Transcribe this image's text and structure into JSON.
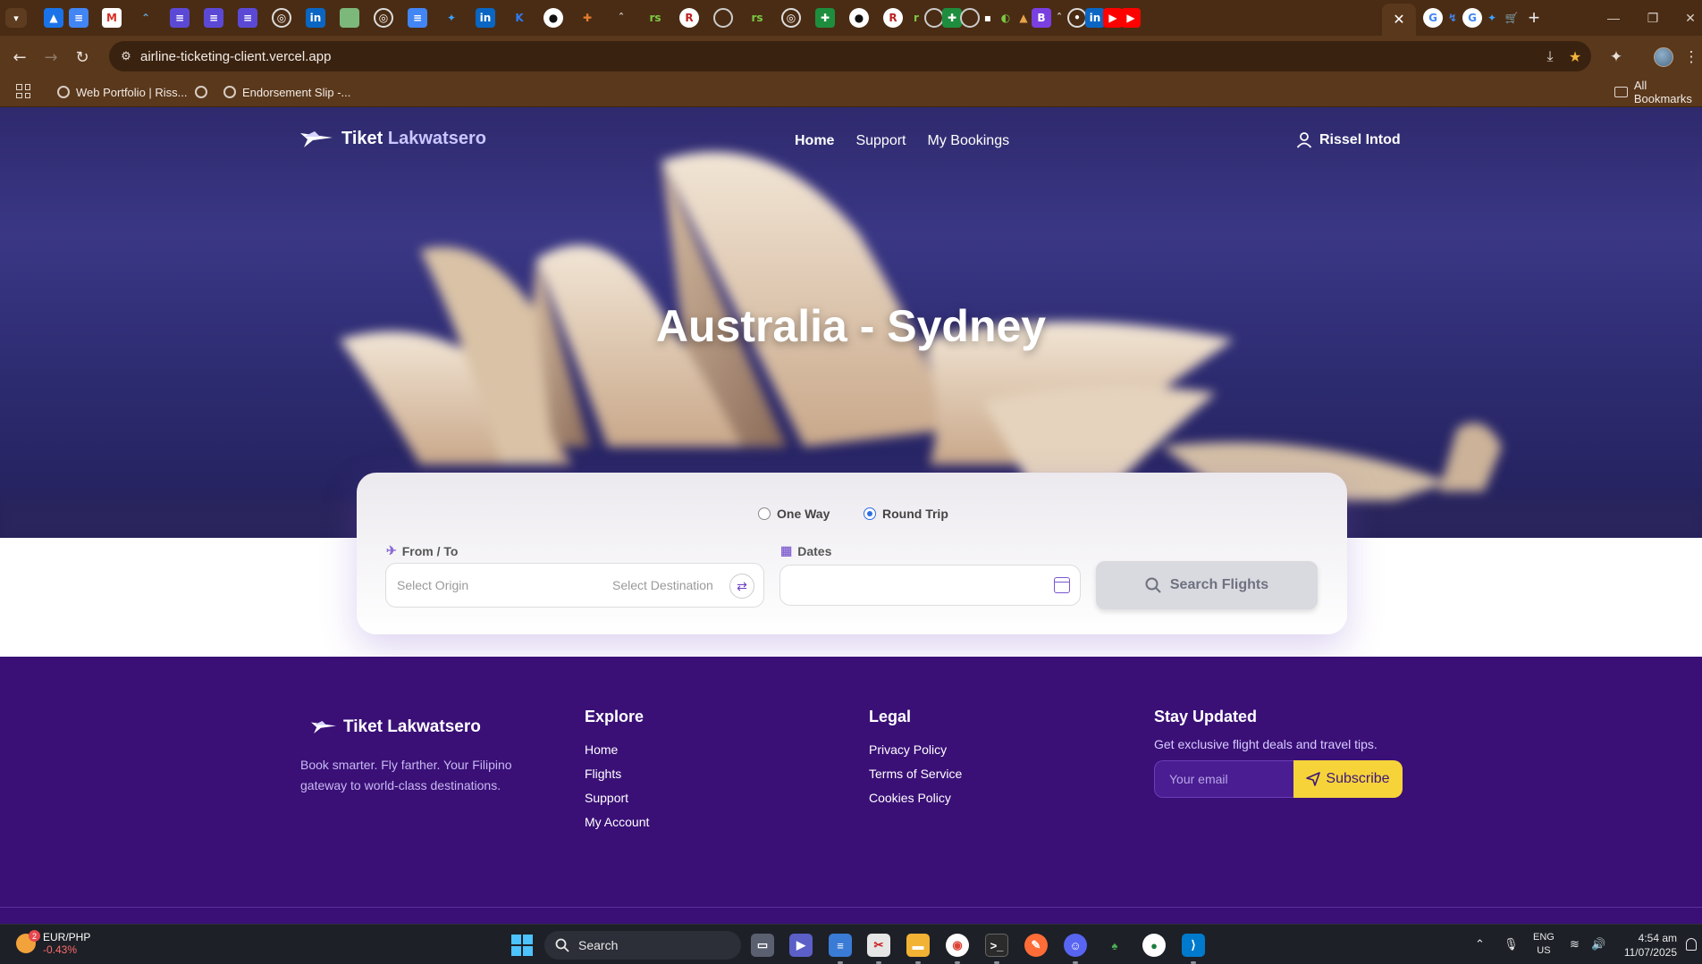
{
  "browser": {
    "url": "airline-ticketing-client.vercel.app",
    "bookmarks": [
      {
        "label": "Web Portfolio | Riss..."
      },
      {
        "label": ""
      },
      {
        "label": "Endorsement Slip -..."
      }
    ],
    "all_bookmarks_label": "All Bookmarks"
  },
  "site": {
    "brand_first": "Tiket",
    "brand_second": "Lakwatsero",
    "nav": {
      "home": "Home",
      "support": "Support",
      "my_bookings": "My Bookings"
    },
    "user_name": "Rissel Intod",
    "hero_title": "Australia - Sydney"
  },
  "search": {
    "one_way": "One Way",
    "round_trip": "Round Trip",
    "selected_trip": "Round Trip",
    "from_to_label": "From / To",
    "origin_placeholder": "Select Origin",
    "destination_placeholder": "Select Destination",
    "dates_label": "Dates",
    "dates_value": "",
    "search_button": "Search Flights"
  },
  "footer": {
    "brand": "Tiket Lakwatsero",
    "tagline": "Book smarter. Fly farther. Your Filipino gateway to world-class destinations.",
    "explore": {
      "title": "Explore",
      "links": [
        "Home",
        "Flights",
        "Support",
        "My Account"
      ]
    },
    "legal": {
      "title": "Legal",
      "links": [
        "Privacy Policy",
        "Terms of Service",
        "Cookies Policy"
      ]
    },
    "stay_updated": {
      "title": "Stay Updated",
      "text": "Get exclusive flight deals and travel tips.",
      "email_placeholder": "Your email",
      "subscribe": "Subscribe"
    }
  },
  "taskbar": {
    "ticker_name": "EUR/PHP",
    "ticker_change": "-0.43%",
    "ticker_badge": "2",
    "search_label": "Search",
    "lang_top": "ENG",
    "lang_bottom": "US",
    "time": "4:54 am",
    "date": "11/07/2025"
  },
  "colors": {
    "hero_bg": "#2e2c72",
    "footer_bg": "#3a1077",
    "subscribe_btn": "#f7d33a",
    "radio_accent": "#2f6de0"
  }
}
